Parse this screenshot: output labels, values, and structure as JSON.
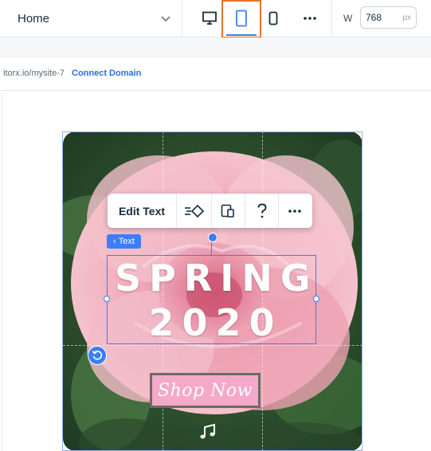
{
  "topbar": {
    "page_select": {
      "value": "Home"
    },
    "devices": {
      "desktop": "desktop-icon",
      "tablet": "tablet-icon",
      "mobile": "mobile-icon",
      "more": "more-icon",
      "active": "tablet"
    },
    "width": {
      "label": "W",
      "value": "768",
      "unit": "px"
    }
  },
  "urlbar": {
    "url": "itorx.io/mysite-7",
    "connect_label": "Connect Domain"
  },
  "floating_toolbar": {
    "edit_label": "Edit Text",
    "icons": [
      "animation-icon",
      "layout-icon",
      "help-icon",
      "more-icon"
    ]
  },
  "selection": {
    "badge_label": "Text"
  },
  "hero": {
    "line1": "SPRING",
    "line2": "2020",
    "button_label": "Shop Now"
  },
  "colors": {
    "accent": "#3b7ef8",
    "highlight": "#e8712c",
    "button_bg": "#f4a9c8",
    "link": "#2b6fd6"
  }
}
